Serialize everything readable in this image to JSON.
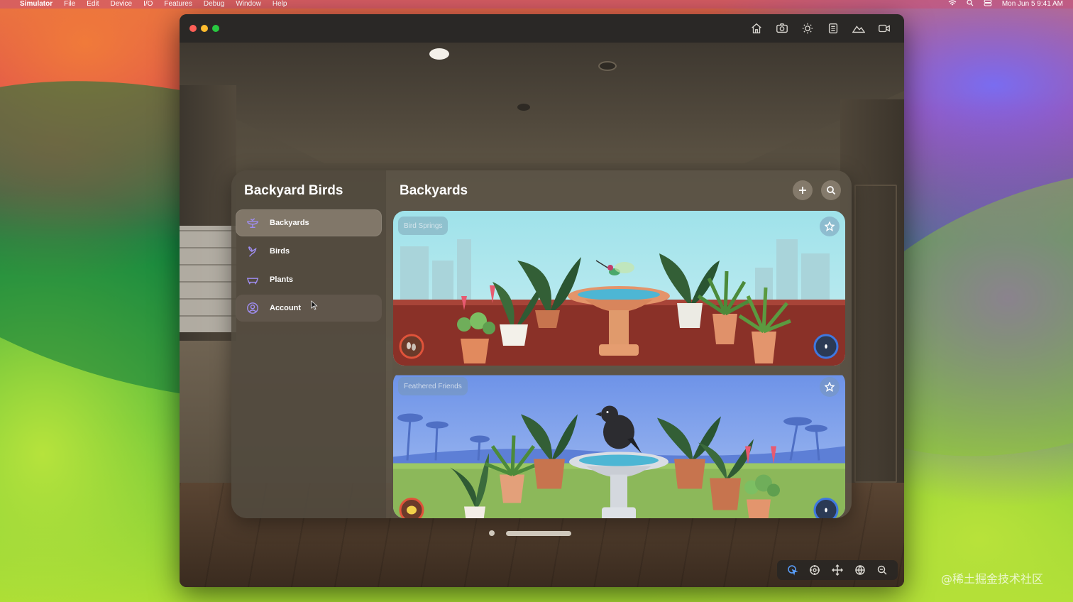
{
  "menubar": {
    "apple_symbol": "",
    "items": [
      "Simulator",
      "File",
      "Edit",
      "Device",
      "I/O",
      "Features",
      "Debug",
      "Window",
      "Help"
    ],
    "datetime": "Mon Jun 5  9:41 AM"
  },
  "sidebar": {
    "title": "Backyard Birds",
    "items": [
      {
        "label": "Backyards",
        "icon": "birdbath-icon",
        "selected": true
      },
      {
        "label": "Birds",
        "icon": "bird-icon"
      },
      {
        "label": "Plants",
        "icon": "planter-icon"
      },
      {
        "label": "Account",
        "icon": "person-circle-icon"
      }
    ]
  },
  "main": {
    "title": "Backyards",
    "cards": [
      {
        "name": "Bird Springs",
        "favorite": false
      },
      {
        "name": "Feathered Friends",
        "favorite": false
      }
    ]
  },
  "watermark": "@稀土掘金技术社区",
  "colors": {
    "accent": "#9f8df0",
    "food_ring": "#e0533a",
    "water_ring": "#3f78e0"
  }
}
